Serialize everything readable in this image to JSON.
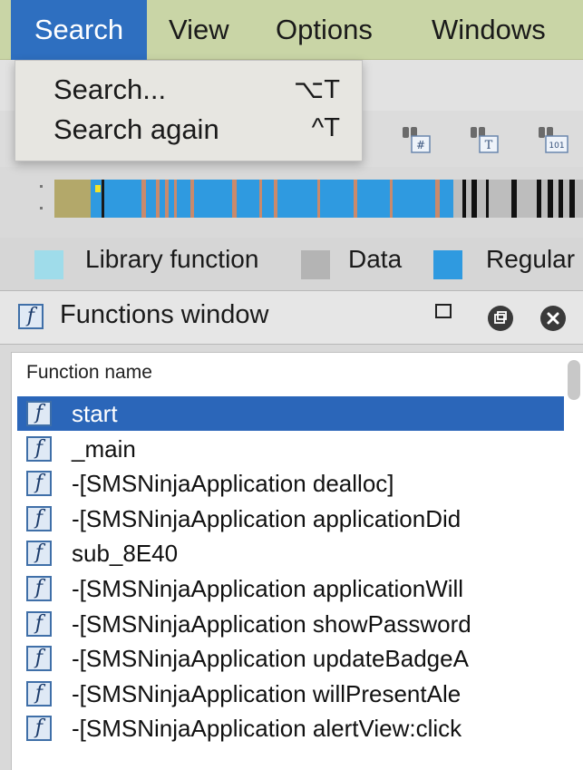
{
  "menubar": {
    "items": [
      {
        "label": "Search",
        "active": true
      },
      {
        "label": "View"
      },
      {
        "label": "Options"
      },
      {
        "label": "Windows"
      }
    ]
  },
  "search_menu": {
    "items": [
      {
        "label": "Search...",
        "shortcut": "⌥T"
      },
      {
        "label": "Search again",
        "shortcut": "^T"
      }
    ]
  },
  "toolbar": {
    "icons": [
      "binoculars-hash-icon",
      "binoculars-text-icon",
      "binoculars-binary-icon"
    ],
    "icon_labels": [
      "#",
      "T",
      "101"
    ]
  },
  "legend": {
    "items": [
      {
        "label": "Library function",
        "color": "#9fdcea"
      },
      {
        "label": "Data",
        "color": "#b4b4b4"
      },
      {
        "label": "Regular",
        "color": "#2f9ae0"
      }
    ]
  },
  "functions_window": {
    "title": "Functions window",
    "column_header": "Function name",
    "rows": [
      "start",
      "_main",
      "-[SMSNinjaApplication dealloc]",
      "-[SMSNinjaApplication applicationDid",
      "sub_8E40",
      "-[SMSNinjaApplication applicationWill",
      "-[SMSNinjaApplication showPassword",
      "-[SMSNinjaApplication updateBadgeA",
      "-[SMSNinjaApplication willPresentAle",
      "-[SMSNinjaApplication alertView:click"
    ],
    "selected_index": 0
  },
  "colors": {
    "menubar": "#c9d5a6",
    "menu_active": "#2e6fc0",
    "selection": "#2b66b9",
    "regular_function": "#2f9ae0"
  }
}
